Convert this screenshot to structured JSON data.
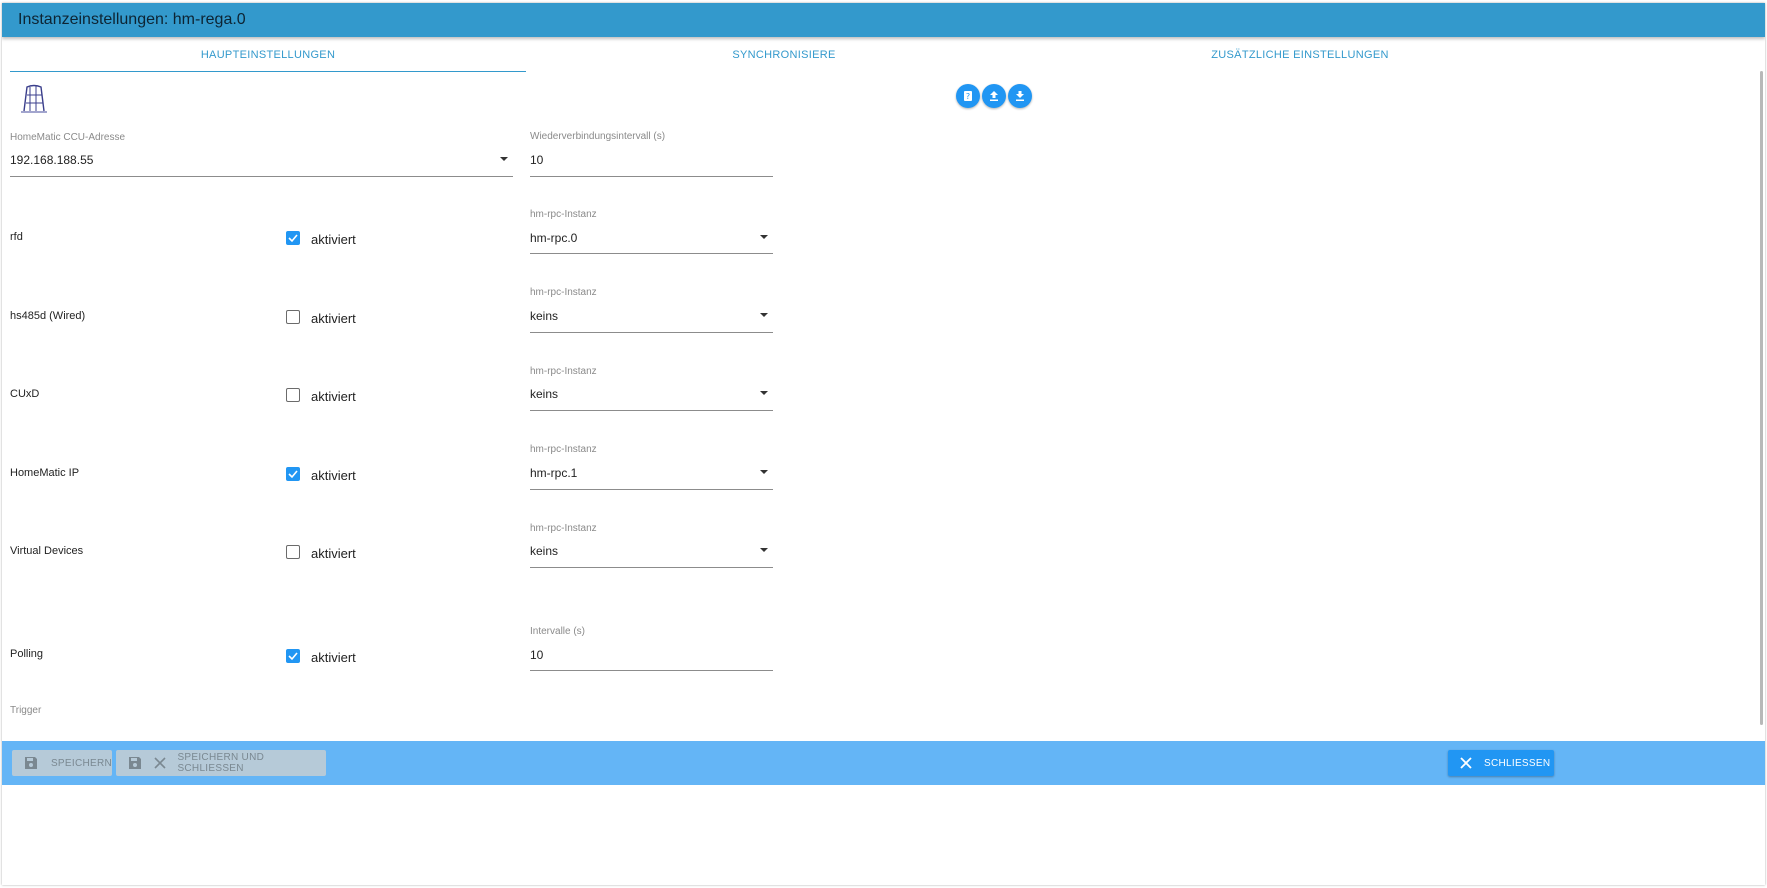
{
  "window": {
    "title": "Instanzeinstellungen: hm-rega.0"
  },
  "tabs": [
    {
      "label": "HAUPTEINSTELLUNGEN",
      "active": true
    },
    {
      "label": "SYNCHRONISIERE",
      "active": false
    },
    {
      "label": "ZUSÄTZLICHE EINSTELLUNGEN",
      "active": false
    }
  ],
  "toolbar_icons": [
    "help-icon",
    "upload-icon",
    "download-icon"
  ],
  "ccu": {
    "label": "HomeMatic CCU-Adresse",
    "value": "192.168.188.55"
  },
  "reconnect": {
    "label": "Wiederverbindungsintervall (s)",
    "value": "10"
  },
  "checkbox_text": "aktiviert",
  "rows": [
    {
      "name": "rfd",
      "enabled": true,
      "instance_label": "hm-rpc-Instanz",
      "instance": "hm-rpc.0"
    },
    {
      "name": "hs485d (Wired)",
      "enabled": false,
      "instance_label": "hm-rpc-Instanz",
      "instance": "keins"
    },
    {
      "name": "CUxD",
      "enabled": false,
      "instance_label": "hm-rpc-Instanz",
      "instance": "keins"
    },
    {
      "name": "HomeMatic IP",
      "enabled": true,
      "instance_label": "hm-rpc-Instanz",
      "instance": "hm-rpc.1"
    },
    {
      "name": "Virtual Devices",
      "enabled": false,
      "instance_label": "hm-rpc-Instanz",
      "instance": "keins"
    }
  ],
  "polling": {
    "name": "Polling",
    "enabled": true,
    "interval_label": "Intervalle (s)",
    "interval": "10"
  },
  "trigger": {
    "label": "Trigger"
  },
  "footer": {
    "save_label": "SPEICHERN",
    "save_close_label": "SPEICHERN UND SCHLIESSEN",
    "close_label": "SCHLIESSEN"
  },
  "colors": {
    "accent": "#2196f3",
    "titlebar": "#3399cc",
    "footer": "#64b5f6"
  }
}
